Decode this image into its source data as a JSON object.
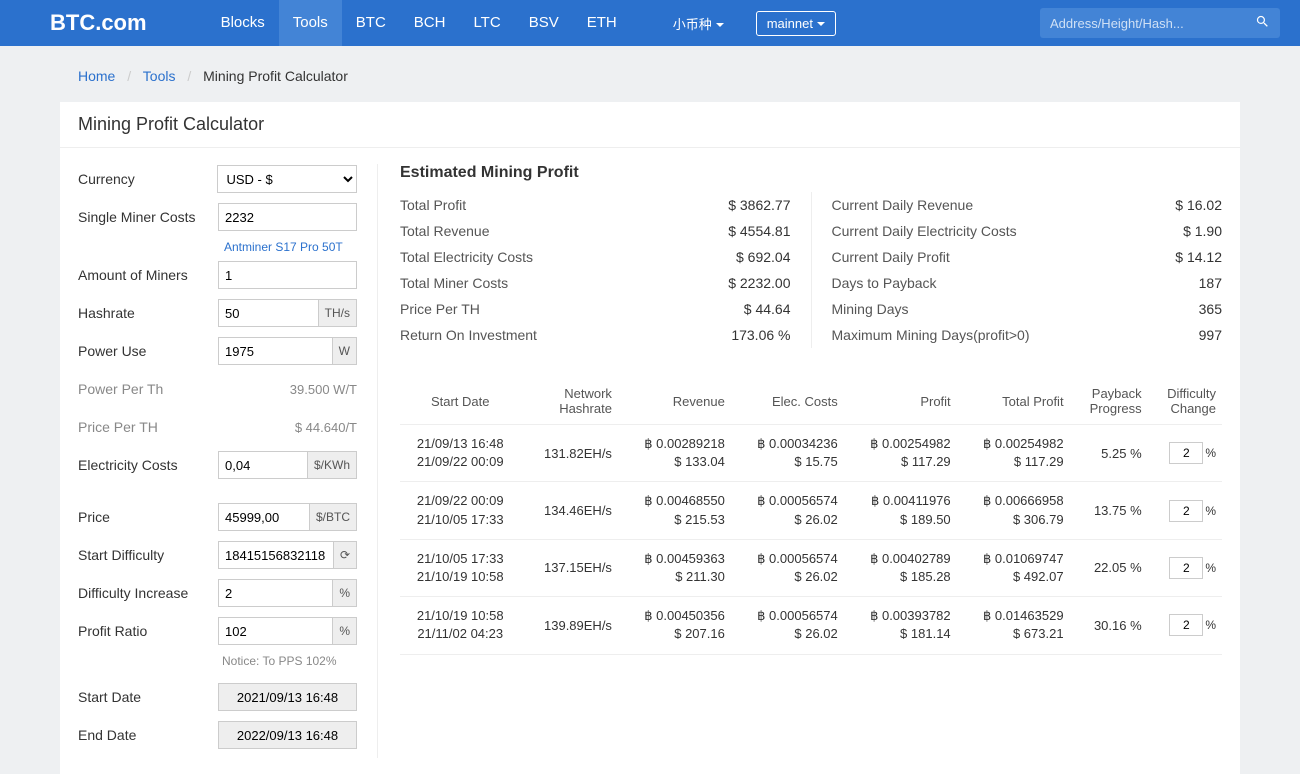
{
  "nav": {
    "logo": "BTC.com",
    "links": [
      "Blocks",
      "Tools",
      "BTC",
      "BCH",
      "LTC",
      "BSV",
      "ETH"
    ],
    "active_index": 1,
    "small_coins": "小币种",
    "network": "mainnet",
    "search_placeholder": "Address/Height/Hash..."
  },
  "breadcrumb": {
    "home": "Home",
    "tools": "Tools",
    "current": "Mining Profit Calculator"
  },
  "page_title": "Mining Profit Calculator",
  "form": {
    "currency_label": "Currency",
    "currency_value": "USD - $",
    "single_miner_label": "Single Miner Costs",
    "single_miner_value": "2232",
    "miner_link": "Antminer S17 Pro 50T",
    "amount_label": "Amount of Miners",
    "amount_value": "1",
    "hashrate_label": "Hashrate",
    "hashrate_value": "50",
    "hashrate_unit": "TH/s",
    "power_use_label": "Power Use",
    "power_use_value": "1975",
    "power_use_unit": "W",
    "power_per_th_label": "Power Per Th",
    "power_per_th_value": "39.500 W/T",
    "price_per_th_label": "Price Per TH",
    "price_per_th_value": "$ 44.640/T",
    "elec_cost_label": "Electricity Costs",
    "elec_cost_value": "0,04",
    "elec_cost_unit": "$/KWh",
    "price_label": "Price",
    "price_value": "45999,00",
    "price_unit": "$/BTC",
    "start_diff_label": "Start Difficulty",
    "start_diff_value": "18415156832118",
    "start_diff_unit": "⟳",
    "diff_inc_label": "Difficulty Increase",
    "diff_inc_value": "2",
    "diff_inc_unit": "%",
    "profit_ratio_label": "Profit Ratio",
    "profit_ratio_value": "102",
    "profit_ratio_unit": "%",
    "notice": "Notice: To PPS 102%",
    "start_date_label": "Start Date",
    "start_date_value": "2021/09/13 16:48",
    "end_date_label": "End Date",
    "end_date_value": "2022/09/13 16:48"
  },
  "summary": {
    "title": "Estimated Mining Profit",
    "left": [
      {
        "label": "Total Profit",
        "value": "$ 3862.77"
      },
      {
        "label": "Total Revenue",
        "value": "$ 4554.81"
      },
      {
        "label": "Total Electricity Costs",
        "value": "$ 692.04"
      },
      {
        "label": "Total Miner Costs",
        "value": "$ 2232.00"
      },
      {
        "label": "Price Per TH",
        "value": "$ 44.64"
      },
      {
        "label": "Return On Investment",
        "value": "173.06 %"
      }
    ],
    "right": [
      {
        "label": "Current Daily Revenue",
        "value": "$ 16.02"
      },
      {
        "label": "Current Daily Electricity Costs",
        "value": "$ 1.90"
      },
      {
        "label": "Current Daily Profit",
        "value": "$ 14.12"
      },
      {
        "label": "Days to Payback",
        "value": "187"
      },
      {
        "label": "Mining Days",
        "value": "365"
      },
      {
        "label": "Maximum Mining Days(profit>0)",
        "value": "997"
      }
    ]
  },
  "table": {
    "headers": [
      "Start Date",
      "Network\nHashrate",
      "Revenue",
      "Elec. Costs",
      "Profit",
      "Total Profit",
      "Payback\nProgress",
      "Difficulty\nChange"
    ],
    "rows": [
      {
        "dates": [
          "21/09/13 16:48",
          "21/09/22 00:09"
        ],
        "hash": "131.82EH/s",
        "rev": [
          "฿ 0.00289218",
          "$ 133.04"
        ],
        "elec": [
          "฿ 0.00034236",
          "$ 15.75"
        ],
        "profit": [
          "฿ 0.00254982",
          "$ 117.29"
        ],
        "tprofit": [
          "฿ 0.00254982",
          "$ 117.29"
        ],
        "payback": "5.25 %",
        "diff": "2"
      },
      {
        "dates": [
          "21/09/22 00:09",
          "21/10/05 17:33"
        ],
        "hash": "134.46EH/s",
        "rev": [
          "฿ 0.00468550",
          "$ 215.53"
        ],
        "elec": [
          "฿ 0.00056574",
          "$ 26.02"
        ],
        "profit": [
          "฿ 0.00411976",
          "$ 189.50"
        ],
        "tprofit": [
          "฿ 0.00666958",
          "$ 306.79"
        ],
        "payback": "13.75 %",
        "diff": "2"
      },
      {
        "dates": [
          "21/10/05 17:33",
          "21/10/19 10:58"
        ],
        "hash": "137.15EH/s",
        "rev": [
          "฿ 0.00459363",
          "$ 211.30"
        ],
        "elec": [
          "฿ 0.00056574",
          "$ 26.02"
        ],
        "profit": [
          "฿ 0.00402789",
          "$ 185.28"
        ],
        "tprofit": [
          "฿ 0.01069747",
          "$ 492.07"
        ],
        "payback": "22.05 %",
        "diff": "2"
      },
      {
        "dates": [
          "21/10/19 10:58",
          "21/11/02 04:23"
        ],
        "hash": "139.89EH/s",
        "rev": [
          "฿ 0.00450356",
          "$ 207.16"
        ],
        "elec": [
          "฿ 0.00056574",
          "$ 26.02"
        ],
        "profit": [
          "฿ 0.00393782",
          "$ 181.14"
        ],
        "tprofit": [
          "฿ 0.01463529",
          "$ 673.21"
        ],
        "payback": "30.16 %",
        "diff": "2"
      }
    ]
  }
}
